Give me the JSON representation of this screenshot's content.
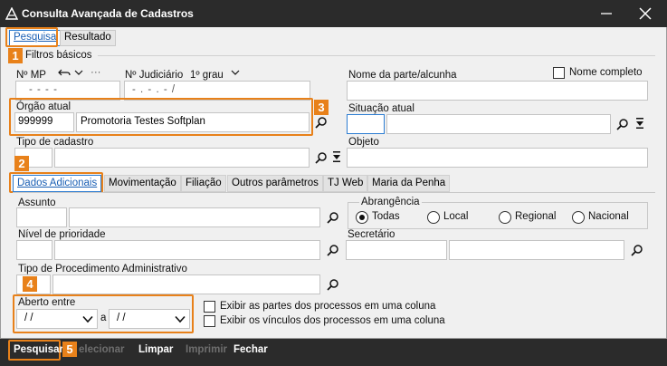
{
  "window": {
    "title": "Consulta Avançada de Cadastros"
  },
  "tabs": [
    {
      "label": "Pesquisa"
    },
    {
      "label": "Resultado"
    }
  ],
  "badges": [
    "1",
    "2",
    "3",
    "4",
    "5"
  ],
  "filtros": {
    "title": "Filtros básicos",
    "nmp_label": "Nº MP",
    "njud_label": "Nº Judiciário",
    "grau_label": "1º grau",
    "ellipsis": "···",
    "mp_mask": "-   -   -   -",
    "jud_mask": "-  .  -  .  -  /",
    "nome_parte_label": "Nome da parte/alcunha",
    "nome_completo_label": "Nome completo",
    "orgao_label": "Órgão atual",
    "orgao_code": "999999",
    "orgao_name": "Promotoria Testes Softplan",
    "situacao_label": "Situação atual",
    "tipo_cadastro_label": "Tipo de cadastro",
    "objeto_label": "Objeto"
  },
  "subtabs": [
    {
      "label": "Dados Adicionais"
    },
    {
      "label": "Movimentação"
    },
    {
      "label": "Filiação"
    },
    {
      "label": "Outros parâmetros"
    },
    {
      "label": "TJ Web"
    },
    {
      "label": "Maria da Penha"
    }
  ],
  "dados": {
    "assunto_label": "Assunto",
    "abrangencia_label": "Abrangência",
    "abrangencia_options": [
      "Todas",
      "Local",
      "Regional",
      "Nacional"
    ],
    "abrangencia_selected": "Todas",
    "nivel_label": "Nível de prioridade",
    "secretario_label": "Secretário",
    "tipo_proc_label": "Tipo de Procedimento Administrativo",
    "aberto_label": "Aberto entre",
    "date_from": "/ /",
    "date_to": "/ /",
    "a_label": "a",
    "exibir_partes": "Exibir as partes dos processos em uma coluna",
    "exibir_vinculos": "Exibir os vínculos dos processos em uma coluna"
  },
  "buttons": {
    "pesquisar": "Pesquisar",
    "selecionar": "elecionar",
    "limpar": "Limpar",
    "imprimir": "Imprimir",
    "fechar": "Fechar"
  },
  "colors": {
    "accent": "#e8811a",
    "tab_blue": "#2d7dd2",
    "titlebar": "#2b2b2b"
  }
}
